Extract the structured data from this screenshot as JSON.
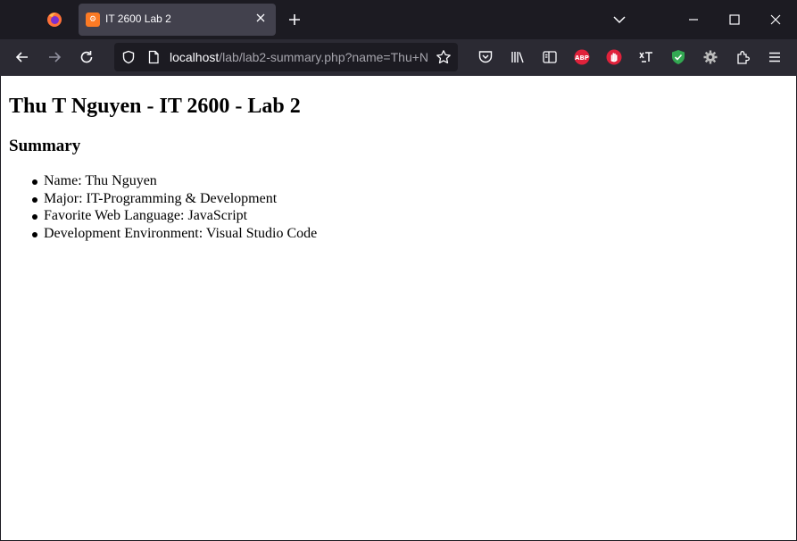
{
  "browser": {
    "tab": {
      "title": "IT 2600 Lab 2",
      "favicon_text": "⚙"
    },
    "url": {
      "host": "localhost",
      "path": "/lab/lab2-summary.php?name=Thu+N"
    },
    "colors": {
      "tabstrip": "#1c1b22",
      "toolbar": "#2b2a33",
      "active_tab": "#42414d",
      "abp": "#e0223b",
      "shield": "#33a852"
    }
  },
  "page": {
    "title": "Thu T Nguyen - IT 2600 - Lab 2",
    "section_title": "Summary",
    "items": [
      "Name: Thu Nguyen",
      "Major: IT-Programming & Development",
      "Favorite Web Language: JavaScript",
      "Development Environment: Visual Studio Code"
    ]
  }
}
